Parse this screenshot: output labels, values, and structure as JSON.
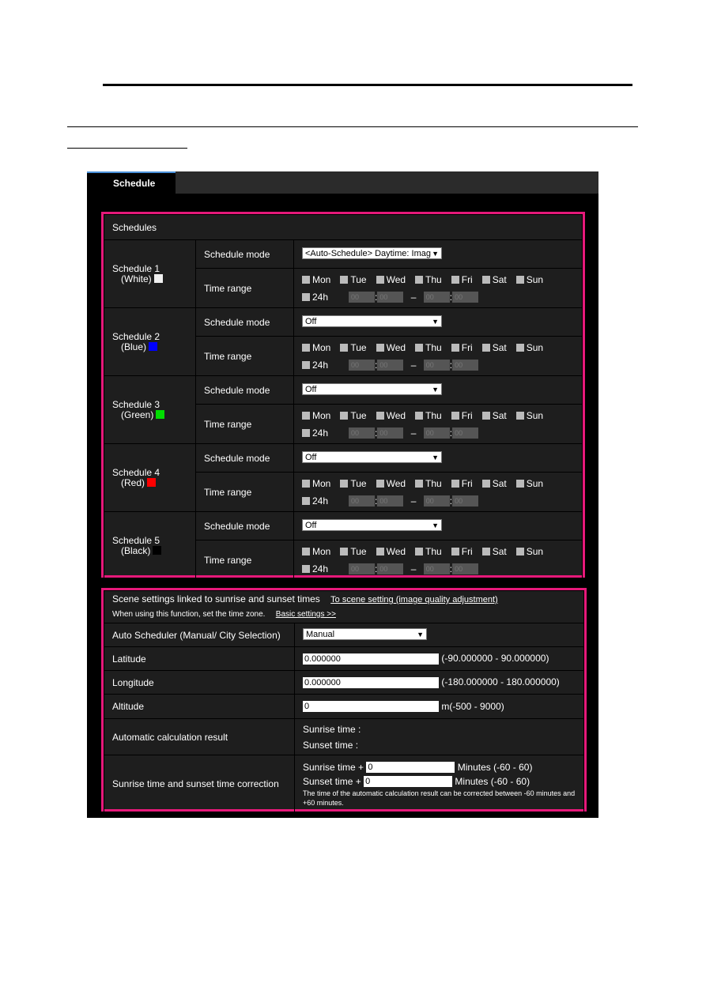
{
  "tab": {
    "label": "Schedule"
  },
  "schedules": {
    "title": "Schedules",
    "mode_label": "Schedule mode",
    "range_label": "Time range",
    "days": [
      "Mon",
      "Tue",
      "Wed",
      "Thu",
      "Fri",
      "Sat",
      "Sun"
    ],
    "h24": "24h",
    "time_placeholder": "00",
    "dash": "–",
    "colon": ":",
    "items": [
      {
        "name": "Schedule 1",
        "color_name": "(White)",
        "color": "#f0f0f0",
        "mode": "<Auto-Schedule> Daytime: Imag"
      },
      {
        "name": "Schedule 2",
        "color_name": "(Blue)",
        "color": "#0000ff",
        "mode": "Off"
      },
      {
        "name": "Schedule 3",
        "color_name": "(Green)",
        "color": "#00dd00",
        "mode": "Off"
      },
      {
        "name": "Schedule 4",
        "color_name": "(Red)",
        "color": "#ff0000",
        "mode": "Off"
      },
      {
        "name": "Schedule 5",
        "color_name": "(Black)",
        "color": "#000000",
        "mode": "Off"
      }
    ]
  },
  "scene": {
    "title": "Scene settings linked to sunrise and sunset times",
    "link1": "To scene setting (image quality adjustment)",
    "note": "When using this function, set the time zone.",
    "link2": "Basic settings >>",
    "auto_label": "Auto Scheduler (Manual/ City Selection)",
    "auto_value": "Manual",
    "lat_label": "Latitude",
    "lat_value": "0.000000",
    "lat_range": "(-90.000000 - 90.000000)",
    "lon_label": "Longitude",
    "lon_value": "0.000000",
    "lon_range": "(-180.000000 - 180.000000)",
    "alt_label": "Altitude",
    "alt_value": "0",
    "alt_range": "m(-500 - 9000)",
    "calc_label": "Automatic calculation result",
    "sunrise": "Sunrise time :",
    "sunset": "Sunset time :",
    "corr_label": "Sunrise time and sunset time correction",
    "sunrise_plus": "Sunrise time +",
    "sunset_plus": "Sunset time +",
    "sunrise_corr": "0",
    "sunset_corr": "0",
    "minutes_range": "Minutes (-60 - 60)",
    "corr_note": "The time of the automatic calculation result can be corrected between -60 minutes and +60 minutes."
  }
}
